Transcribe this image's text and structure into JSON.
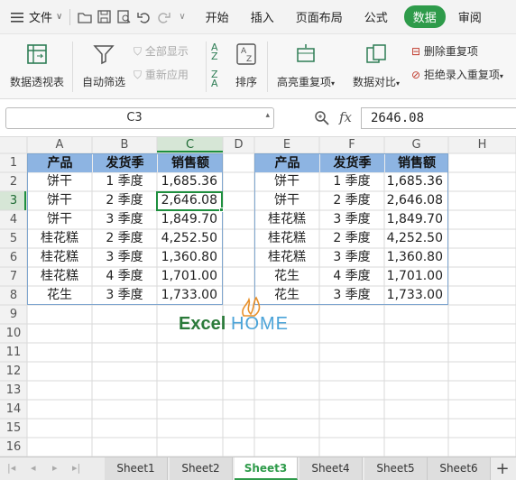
{
  "topbar": {
    "menu_label": "文件",
    "tabs": [
      "开始",
      "插入",
      "页面布局",
      "公式",
      "数据",
      "审阅"
    ],
    "active_tab": "数据"
  },
  "ribbon": {
    "pivot": "数据透视表",
    "autofilter": "自动筛选",
    "show_all": "全部显示",
    "reapply": "重新应用",
    "sort": "排序",
    "highlight_dup": "高亮重复项",
    "compare": "数据对比",
    "remove_dup": "删除重复项",
    "reject_dup": "拒绝录入重复项"
  },
  "formula_bar": {
    "name_box": "C3",
    "fx": "fx",
    "value": "2646.08"
  },
  "columns": [
    "A",
    "B",
    "C",
    "D",
    "E",
    "F",
    "G",
    "H"
  ],
  "rows": [
    "1",
    "2",
    "3",
    "4",
    "5",
    "6",
    "7",
    "8",
    "9",
    "10",
    "11",
    "12",
    "13",
    "14",
    "15",
    "16",
    "17"
  ],
  "table_left": {
    "headers": [
      "产品",
      "发货季",
      "销售额"
    ],
    "rows": [
      [
        "饼干",
        "1 季度",
        "1,685.36"
      ],
      [
        "饼干",
        "2 季度",
        "2,646.08"
      ],
      [
        "饼干",
        "3 季度",
        "1,849.70"
      ],
      [
        "桂花糕",
        "2 季度",
        "4,252.50"
      ],
      [
        "桂花糕",
        "3 季度",
        "1,360.80"
      ],
      [
        "桂花糕",
        "4 季度",
        "1,701.00"
      ],
      [
        "花生",
        "3 季度",
        "1,733.00"
      ]
    ]
  },
  "table_right": {
    "headers": [
      "产品",
      "发货季",
      "销售额"
    ],
    "rows": [
      [
        "饼干",
        "1 季度",
        "1,685.36"
      ],
      [
        "饼干",
        "2 季度",
        "2,646.08"
      ],
      [
        "桂花糕",
        "3 季度",
        "1,849.70"
      ],
      [
        "桂花糕",
        "2 季度",
        "4,252.50"
      ],
      [
        "桂花糕",
        "3 季度",
        "1,360.80"
      ],
      [
        "花生",
        "4 季度",
        "1,701.00"
      ],
      [
        "花生",
        "3 季度",
        "1,733.00"
      ]
    ]
  },
  "watermark": {
    "excel": "Excel",
    "home": "HOME"
  },
  "sheets": [
    "Sheet1",
    "Sheet2",
    "Sheet3",
    "Sheet4",
    "Sheet5",
    "Sheet6"
  ],
  "active_sheet": "Sheet3",
  "colors": {
    "accent": "#2e9b4a",
    "header_fill": "#8db4e2",
    "selection": "#1e8f3e"
  }
}
